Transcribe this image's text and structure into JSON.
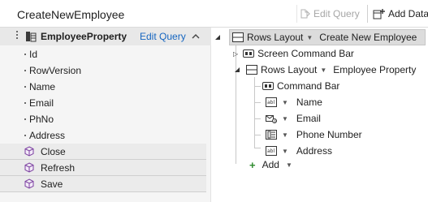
{
  "header": {
    "screen_title": "CreateNewEmployee",
    "edit_query_label": "Edit Query",
    "add_data_label": "Add Data"
  },
  "entity": {
    "name": "EmployeeProperty",
    "edit_query_label": "Edit Query",
    "fields": [
      "Id",
      "RowVersion",
      "Name",
      "Email",
      "PhNo",
      "Address"
    ],
    "methods": [
      "Close",
      "Refresh",
      "Save"
    ]
  },
  "tree": {
    "root": {
      "layout": "Rows Layout",
      "name": "Create New Employee"
    },
    "screen_command_bar": "Screen Command Bar",
    "inner": {
      "layout": "Rows Layout",
      "name": "Employee Property"
    },
    "command_bar": "Command Bar",
    "items": [
      {
        "label": "Name",
        "icon": "textbox-icon"
      },
      {
        "label": "Email",
        "icon": "email-icon"
      },
      {
        "label": "Phone Number",
        "icon": "phone-icon"
      },
      {
        "label": "Address",
        "icon": "textbox-icon"
      }
    ],
    "add_label": "Add"
  }
}
